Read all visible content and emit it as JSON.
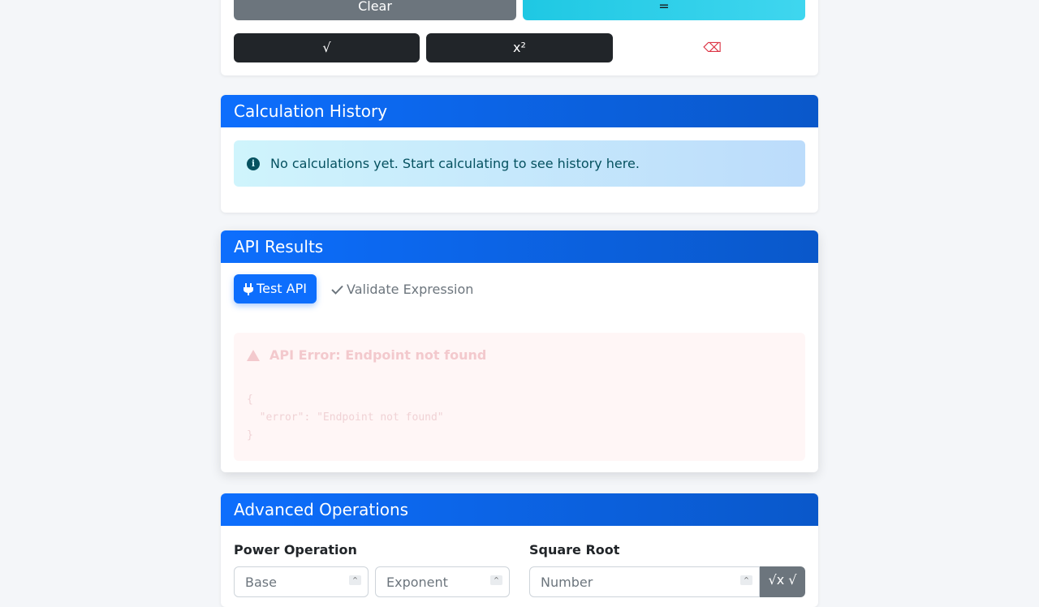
{
  "calculator": {
    "clear_label": "Clear",
    "equals_label": "=",
    "sqrt_label": "√",
    "square_label": "x²",
    "backspace_label": "⌫"
  },
  "history": {
    "title": "Calculation History",
    "empty_message": "No calculations yet. Start calculating to see history here."
  },
  "api_results": {
    "title": "API Results",
    "test_api_label": "Test API",
    "validate_label": "Validate Expression",
    "error_title": "API Error: Endpoint not found",
    "error_body": "{\n  \"error\": \"Endpoint not found\"\n}"
  },
  "advanced": {
    "title": "Advanced Operations",
    "power_label": "Power Operation",
    "base_placeholder": "Base",
    "exponent_placeholder": "Exponent",
    "sqrt_section_label": "Square Root",
    "number_placeholder": "Number",
    "sqrt_button_label": "√x √"
  },
  "colors": {
    "primary": "#0d6efd",
    "info": "#1fc8e3",
    "danger": "#dc3545",
    "secondary": "#6c757d",
    "dark": "#212529"
  }
}
